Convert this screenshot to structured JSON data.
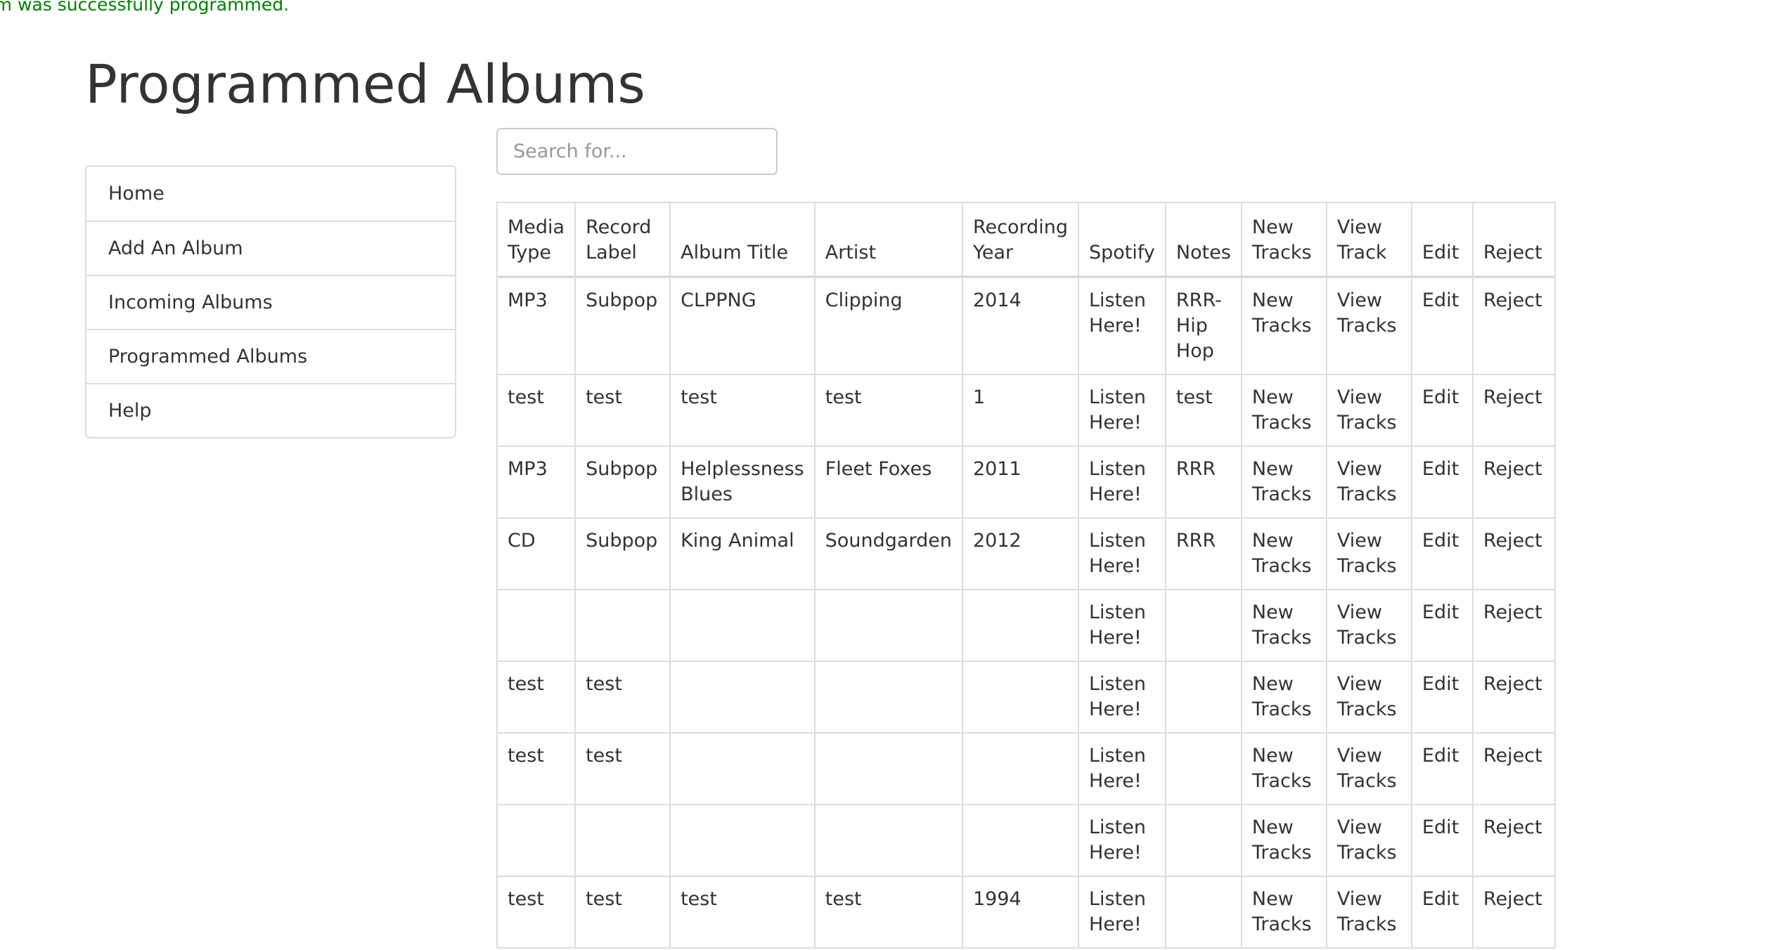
{
  "flash": "lbum was successfully programmed.",
  "page_title": "Programmed Albums",
  "sidebar": {
    "items": [
      {
        "label": "Home"
      },
      {
        "label": "Add An Album"
      },
      {
        "label": "Incoming Albums"
      },
      {
        "label": "Programmed Albums"
      },
      {
        "label": "Help"
      }
    ]
  },
  "search": {
    "placeholder": "Search for...",
    "value": ""
  },
  "table": {
    "headers": [
      "Media Type",
      "Record Label",
      "Album Title",
      "Artist",
      "Recording Year",
      "Spotify",
      "Notes",
      "New Tracks",
      "View Track",
      "Edit",
      "Reject"
    ],
    "link_labels": {
      "spotify": "Listen Here!",
      "new_tracks": "New Tracks",
      "view_tracks": "View Tracks",
      "edit": "Edit",
      "reject": "Reject"
    },
    "rows": [
      {
        "media_type": "MP3",
        "record_label": "Subpop",
        "album_title": "CLPPNG",
        "artist": "Clipping",
        "year": "2014",
        "notes": "RRR-Hip Hop"
      },
      {
        "media_type": "test",
        "record_label": "test",
        "album_title": "test",
        "artist": "test",
        "year": "1",
        "notes": "test"
      },
      {
        "media_type": "MP3",
        "record_label": "Subpop",
        "album_title": "Helplessness Blues",
        "artist": "Fleet Foxes",
        "year": "2011",
        "notes": "RRR"
      },
      {
        "media_type": "CD",
        "record_label": "Subpop",
        "album_title": "King Animal",
        "artist": "Soundgarden",
        "year": "2012",
        "notes": "RRR"
      },
      {
        "media_type": "",
        "record_label": "",
        "album_title": "",
        "artist": "",
        "year": "",
        "notes": ""
      },
      {
        "media_type": "test",
        "record_label": "test",
        "album_title": "",
        "artist": "",
        "year": "",
        "notes": ""
      },
      {
        "media_type": "test",
        "record_label": "test",
        "album_title": "",
        "artist": "",
        "year": "",
        "notes": ""
      },
      {
        "media_type": "",
        "record_label": "",
        "album_title": "",
        "artist": "",
        "year": "",
        "notes": ""
      },
      {
        "media_type": "test",
        "record_label": "test",
        "album_title": "test",
        "artist": "test",
        "year": "1994",
        "notes": ""
      }
    ]
  }
}
